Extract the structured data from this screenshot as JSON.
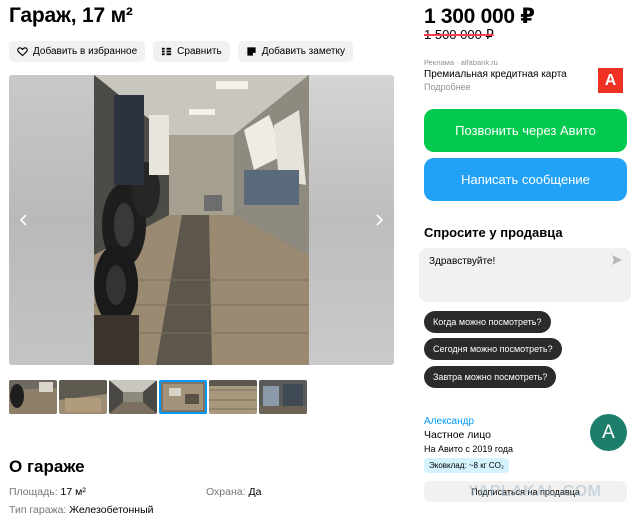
{
  "listing": {
    "title": "Гараж, 17 м²",
    "price": "1 300 000 ₽",
    "old_price": "1 500 000 ₽"
  },
  "actions": {
    "favorite": "Добавить в избранное",
    "compare": "Сравнить",
    "note": "Добавить заметку"
  },
  "gallery": {
    "prev_icon": "chevron-left-icon",
    "next_icon": "chevron-right-icon",
    "thumbnail_count": 6,
    "active_thumbnail": 4
  },
  "about": {
    "heading": "О гараже",
    "area_label": "Площадь:",
    "area_value": "17 м²",
    "type_label": "Тип гаража:",
    "type_value": "Железобетонный",
    "security_label": "Охрана:",
    "security_value": "Да"
  },
  "ad": {
    "tag": "Реклама · alfabank.ru",
    "title": "Премиальная кредитная карта",
    "more": "Подробнее",
    "logo_letter": "А",
    "logo_color": "#ef3124"
  },
  "contact": {
    "call": "Позвонить через Авито",
    "message": "Написать сообщение",
    "call_color": "#04c94f",
    "message_color": "#22a2f7"
  },
  "ask": {
    "title": "Спросите у продавца",
    "input_value": "Здравствуйте!",
    "chips": [
      "Когда можно посмотреть?",
      "Сегодня можно посмотреть?",
      "Завтра можно посмотреть?"
    ]
  },
  "seller": {
    "name": "Александр",
    "type": "Частное лицо",
    "since": "На Авито с 2019 года",
    "eco": "Эковклад: ~8 кг CO₂",
    "avatar_letter": "А",
    "subscribe": "Подписаться на продавца"
  },
  "watermark": "YAPLAKAL.COM"
}
